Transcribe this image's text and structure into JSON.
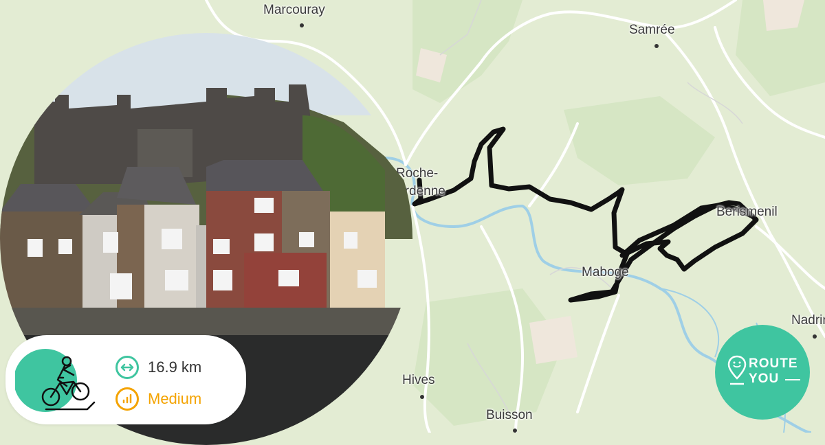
{
  "map": {
    "places": [
      {
        "id": "marcouray",
        "name": "Marcouray"
      },
      {
        "id": "samree",
        "name": "Samrée"
      },
      {
        "id": "roche",
        "name": "Roche-\nArdenne"
      },
      {
        "id": "berismenil",
        "name": "Berismenil"
      },
      {
        "id": "maboge",
        "name": "Maboge"
      },
      {
        "id": "hives",
        "name": "Hives"
      },
      {
        "id": "buisson",
        "name": "Buisson"
      },
      {
        "id": "nadrin",
        "name": "Nadrin"
      }
    ],
    "route_color": "#111111",
    "water_color": "#9fcfe6",
    "land_color": "#e3ecd3"
  },
  "stats": {
    "activity_icon": "mountain-bike-icon",
    "distance_icon": "distance-arrows-icon",
    "distance": "16.9 km",
    "distance_color": "#3fc5a0",
    "difficulty_icon": "difficulty-signal-icon",
    "difficulty": "Medium",
    "difficulty_color": "#f4a300"
  },
  "brand": {
    "line1": "ROUTE",
    "line2": "YOU",
    "color": "#3fc5a0"
  }
}
